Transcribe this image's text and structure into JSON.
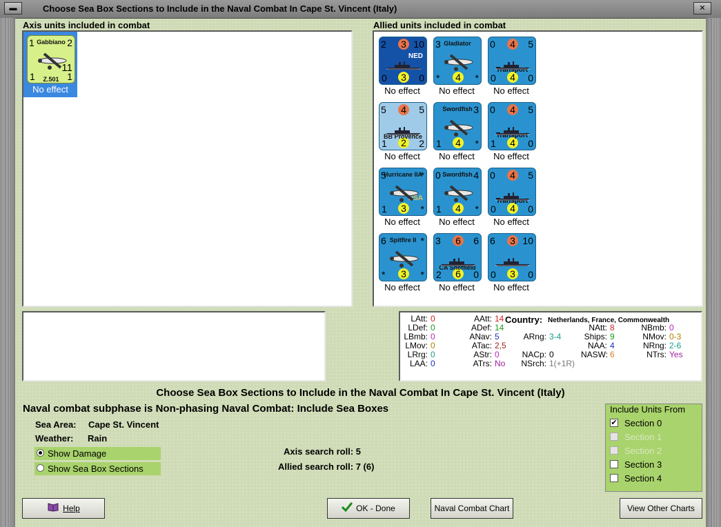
{
  "window": {
    "title": "Choose Sea Box Sections to Include in the Naval Combat In Cape St. Vincent (Italy)"
  },
  "axis_panel": {
    "label": "Axis units included in combat",
    "units": [
      {
        "name": "Gabbiano",
        "tl": "1",
        "tr": "2",
        "bl": "1",
        "br": "1",
        "mid": "11",
        "type": "Z.501",
        "effect": "No effect"
      }
    ]
  },
  "allied_panel": {
    "label": "Allied units included in combat",
    "units": [
      {
        "name": "",
        "nat": "NED",
        "tl": "2",
        "tm": "3",
        "tr": "10",
        "bl": "0",
        "bm": "3",
        "br": "0",
        "kind": "ship",
        "effect": "No effect"
      },
      {
        "name": "Gladiator",
        "tl": "3",
        "tm": "",
        "tr": "",
        "bl": "*",
        "bm": "4",
        "br": "*",
        "kind": "plane",
        "effect": "No effect"
      },
      {
        "name": "Transport",
        "tl": "0",
        "tm": "4",
        "tr": "5",
        "bl": "0",
        "bm": "4",
        "br": "0",
        "kind": "ship",
        "effect": "No effect"
      },
      {
        "name": "BB Provence",
        "tl": "5",
        "tm": "4",
        "tr": "5",
        "bl": "1",
        "bm": "2",
        "br": "2",
        "kind": "ship",
        "effect": "No effect"
      },
      {
        "name": "Swordfish",
        "tl": "",
        "tm": "",
        "tr": "3",
        "bl": "1",
        "bm": "4",
        "br": "*",
        "kind": "plane",
        "effect": "No effect"
      },
      {
        "name": "Transport",
        "tl": "0",
        "tm": "4",
        "tr": "5",
        "bl": "1",
        "bm": "4",
        "br": "0",
        "kind": "ship",
        "effect": "No effect"
      },
      {
        "name": "Hurricane IIA",
        "nat": "RSA",
        "tl": "5",
        "tm": "",
        "tr": "*",
        "bl": "1",
        "bm": "3",
        "br": "*",
        "kind": "plane",
        "effect": "No effect"
      },
      {
        "name": "Swordfish",
        "tl": "0",
        "tm": "",
        "tr": "4",
        "bl": "1",
        "bm": "4",
        "br": "*",
        "kind": "plane",
        "effect": "No effect"
      },
      {
        "name": "Transport",
        "tl": "0",
        "tm": "4",
        "tr": "5",
        "bl": "0",
        "bm": "4",
        "br": "0",
        "kind": "ship",
        "effect": "No effect"
      },
      {
        "name": "Spitfire II",
        "tl": "6",
        "tm": "",
        "tr": "*",
        "bl": "*",
        "bm": "3",
        "br": "*",
        "kind": "plane",
        "effect": "No effect"
      },
      {
        "name": "CA Sheffield",
        "tl": "3",
        "tm": "6",
        "tr": "6",
        "bl": "2",
        "bm": "6",
        "br": "0",
        "kind": "ship",
        "effect": "No effect"
      },
      {
        "name": "",
        "tl": "6",
        "tm": "3",
        "tr": "10",
        "bl": "0",
        "bm": "3",
        "br": "0",
        "kind": "ship",
        "effect": "No effect"
      }
    ]
  },
  "stats": {
    "country_label": "Country:",
    "country_value": "Netherlands, France, Commonwealth",
    "rows": [
      {
        "l": "LAtt:",
        "v": "0",
        "c": "#d02020"
      },
      {
        "l": "LDef:",
        "v": "0",
        "c": "#1a9a1a"
      },
      {
        "l": "LBmb:",
        "v": "0",
        "c": "#c020c0"
      },
      {
        "l": "LMov:",
        "v": "0",
        "c": "#b08000"
      },
      {
        "l": "LRrg:",
        "v": "0",
        "c": "#1a9a8a"
      },
      {
        "l": "LAA:",
        "v": "0",
        "c": "#1a30c0"
      },
      {
        "l": "AAtt:",
        "v": "14",
        "c": "#d02020"
      },
      {
        "l": "ADef:",
        "v": "14",
        "c": "#1a9a1a"
      },
      {
        "l": "ANav:",
        "v": "5",
        "c": "#1a30c0"
      },
      {
        "l": "ATac:",
        "v": "2,5",
        "c": "#a02020"
      },
      {
        "l": "AStr:",
        "v": "0",
        "c": "#c020c0"
      },
      {
        "l": "ATrs:",
        "v": "No",
        "c": "#a020a0"
      },
      {
        "l": "ARng:",
        "v": "3-4",
        "c": "#1a9a8a"
      },
      {
        "l": "NACp:",
        "v": "0",
        "c": "#000"
      },
      {
        "l": "NSrch:",
        "v": "1(+1R)",
        "c": "#777"
      },
      {
        "l": "NAtt:",
        "v": "8",
        "c": "#d02020"
      },
      {
        "l": "Ships:",
        "v": "9",
        "c": "#1a9a1a"
      },
      {
        "l": "NAA:",
        "v": "4",
        "c": "#1a30c0"
      },
      {
        "l": "NASW:",
        "v": "6",
        "c": "#d08020"
      },
      {
        "l": "NBmb:",
        "v": "0",
        "c": "#c020c0"
      },
      {
        "l": "NMov:",
        "v": "0-3",
        "c": "#b08000"
      },
      {
        "l": "NRng:",
        "v": "2-6",
        "c": "#1a9a8a"
      },
      {
        "l": "NTrs:",
        "v": "Yes",
        "c": "#a020a0"
      }
    ]
  },
  "main": {
    "heading": "Choose Sea Box Sections to Include in the Naval Combat In Cape St. Vincent (Italy)",
    "subheading": "Naval combat subphase is Non-phasing Naval Combat: Include Sea Boxes",
    "sea_area_label": "Sea Area:",
    "sea_area_value": "Cape St. Vincent",
    "weather_label": "Weather:",
    "weather_value": "Rain",
    "axis_search": "Axis search roll:  5",
    "allied_search": "Allied search roll:  7 (6)",
    "radio_damage": "Show Damage",
    "radio_sections": "Show Sea Box Sections"
  },
  "include": {
    "title": "Include Units From",
    "sections": [
      {
        "label": "Section 0",
        "checked": true,
        "enabled": true
      },
      {
        "label": "Section 1",
        "checked": false,
        "enabled": false
      },
      {
        "label": "Section 2",
        "checked": false,
        "enabled": false
      },
      {
        "label": "Section 3",
        "checked": false,
        "enabled": true
      },
      {
        "label": "Section 4",
        "checked": false,
        "enabled": true
      }
    ]
  },
  "buttons": {
    "help": "Help",
    "ok": "OK - Done",
    "naval_chart": "Naval Combat Chart",
    "other_charts": "View Other Charts"
  },
  "window_buttons": {
    "close": "✕",
    "minimize": "▬"
  }
}
